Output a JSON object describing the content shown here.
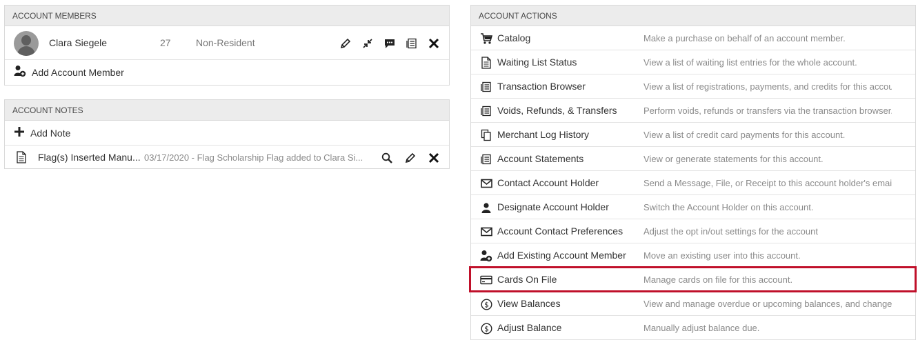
{
  "members_panel": {
    "header": "ACCOUNT MEMBERS",
    "members": [
      {
        "name": "Clara Siegele",
        "age": "27",
        "type": "Non-Resident"
      }
    ],
    "add_label": "Add Account Member"
  },
  "notes_panel": {
    "header": "ACCOUNT NOTES",
    "add_label": "Add Note",
    "notes": [
      {
        "title": "Flag(s) Inserted Manu...",
        "text": "03/17/2020 - Flag Scholarship Flag added to Clara Si..."
      }
    ]
  },
  "actions_panel": {
    "header": "ACCOUNT ACTIONS",
    "items": [
      {
        "icon": "cart-icon",
        "label": "Catalog",
        "desc": "Make a purchase on behalf of an account member."
      },
      {
        "icon": "document-icon",
        "label": "Waiting List Status",
        "desc": "View a list of waiting list entries for the whole account."
      },
      {
        "icon": "ledger-icon",
        "label": "Transaction Browser",
        "desc": "View a list of registrations, payments, and credits for this accou..."
      },
      {
        "icon": "ledger-icon",
        "label": "Voids, Refunds, & Transfers",
        "desc": "Perform voids, refunds or transfers via the transaction browser."
      },
      {
        "icon": "copy-icon",
        "label": "Merchant Log History",
        "desc": "View a list of credit card payments for this account."
      },
      {
        "icon": "ledger-icon",
        "label": "Account Statements",
        "desc": "View or generate statements for this account."
      },
      {
        "icon": "envelope-icon",
        "label": "Contact Account Holder",
        "desc": "Send a Message, File, or Receipt to this account holder's email ..."
      },
      {
        "icon": "person-icon",
        "label": "Designate Account Holder",
        "desc": "Switch the Account Holder on this account."
      },
      {
        "icon": "envelope-icon",
        "label": "Account Contact Preferences",
        "desc": "Adjust the opt in/out settings for the account"
      },
      {
        "icon": "add-user-icon",
        "label": "Add Existing Account Member",
        "desc": "Move an existing user into this account."
      },
      {
        "icon": "credit-card-icon",
        "label": "Cards On File",
        "desc": "Manage cards on file for this account."
      },
      {
        "icon": "dollar-circle-icon",
        "label": "View Balances",
        "desc": "View and manage overdue or upcoming balances, and change t..."
      },
      {
        "icon": "dollar-circle-icon",
        "label": "Adjust Balance",
        "desc": "Manually adjust balance due."
      }
    ]
  },
  "colors": {
    "highlight": "#c0102a",
    "header_bg": "#ececec",
    "muted_text": "#8a8a8a"
  }
}
